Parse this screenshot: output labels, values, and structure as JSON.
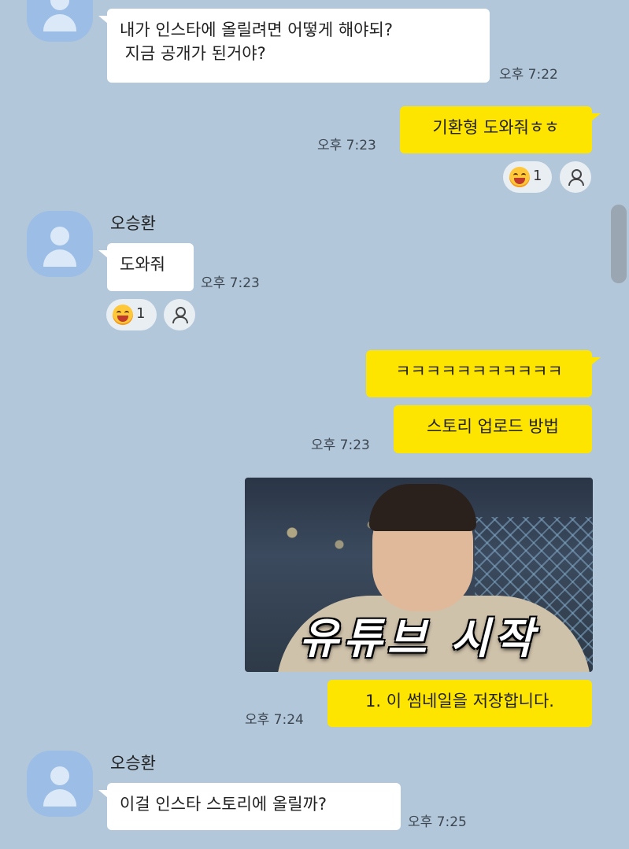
{
  "messages": {
    "m1": {
      "text": "내가 인스타에 올릴려면 어떻게 해야되?\n 지금 공개가 된거야?",
      "time": "오후 7:22"
    },
    "m2": {
      "text": "기환형 도와줘ㅎㅎ",
      "time": "오후 7:23",
      "reaction_count": "1"
    },
    "m3": {
      "sender": "오승환",
      "text": "도와줘",
      "time": "오후 7:23",
      "reaction_count": "1"
    },
    "m4": {
      "text": "ㅋㅋㅋㅋㅋㅋㅋㅋㅋㅋㅋ"
    },
    "m5": {
      "text": "스토리 업로드 방법",
      "time": "오후 7:23"
    },
    "m6": {
      "thumbnail_caption": "유튜브 시작",
      "text": "1. 이 썸네일을 저장합니다.",
      "time": "오후 7:24"
    },
    "m7": {
      "sender": "오승환",
      "text": "이걸 인스타 스토리에 올릴까?",
      "time": "오후 7:25"
    }
  },
  "icons": {
    "avatar": "default-profile-icon",
    "reaction": "laughing-emoji-icon",
    "reaction_user": "person-icon"
  },
  "colors": {
    "background": "#b2c7da",
    "my_bubble": "#fee500",
    "other_bubble": "#ffffff",
    "avatar": "#9bbde6"
  }
}
